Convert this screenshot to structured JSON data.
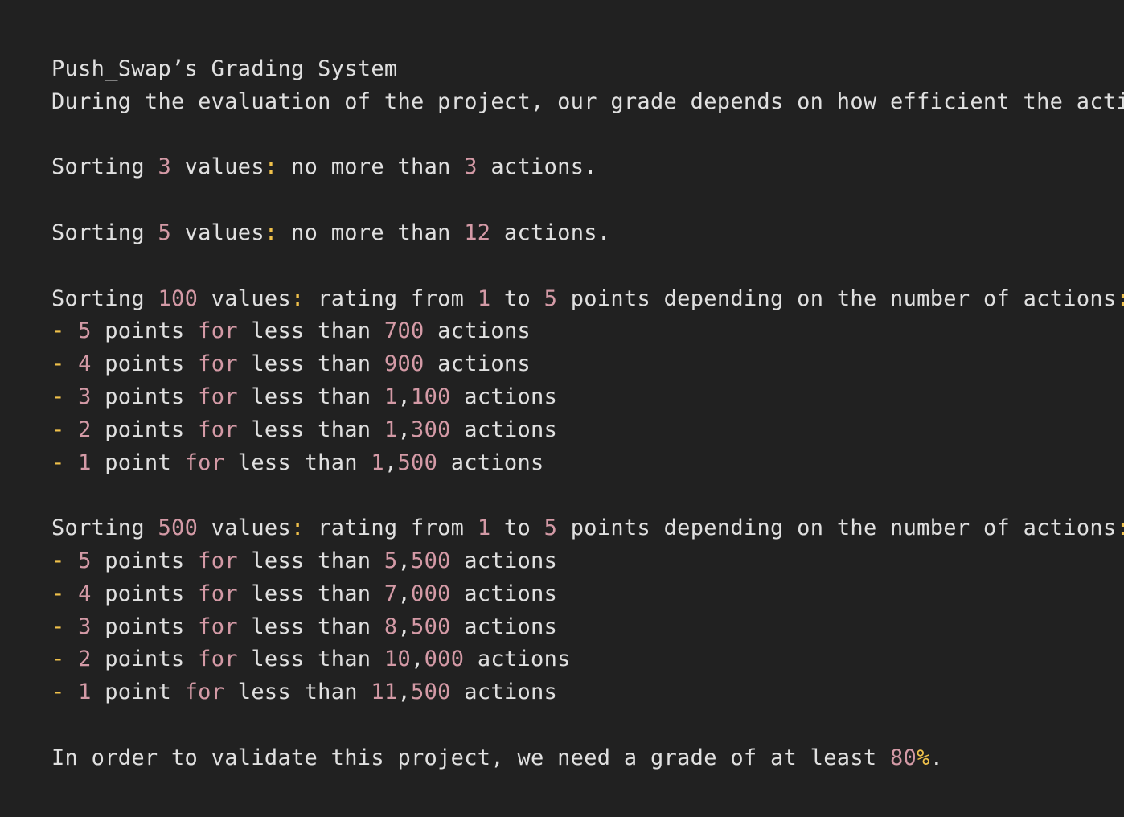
{
  "colors": {
    "background": "#212121",
    "text": "#e0e0e0",
    "number": "#d49aa6",
    "keyword": "#d49aa6",
    "punctuation": "#f0c14b"
  },
  "lines": [
    [
      {
        "t": "Push_Swap’s Grading System",
        "k": "plain"
      }
    ],
    [
      {
        "t": "During the evaluation of the project, our grade depends on how efficient the actions",
        "k": "plain"
      }
    ],
    [],
    [
      {
        "t": "Sorting ",
        "k": "plain"
      },
      {
        "t": "3",
        "k": "num"
      },
      {
        "t": " values",
        "k": "plain"
      },
      {
        "t": ":",
        "k": "punct"
      },
      {
        "t": " no more than ",
        "k": "plain"
      },
      {
        "t": "3",
        "k": "num"
      },
      {
        "t": " actions.",
        "k": "plain"
      }
    ],
    [],
    [
      {
        "t": "Sorting ",
        "k": "plain"
      },
      {
        "t": "5",
        "k": "num"
      },
      {
        "t": " values",
        "k": "plain"
      },
      {
        "t": ":",
        "k": "punct"
      },
      {
        "t": " no more than ",
        "k": "plain"
      },
      {
        "t": "12",
        "k": "num"
      },
      {
        "t": " actions.",
        "k": "plain"
      }
    ],
    [],
    [
      {
        "t": "Sorting ",
        "k": "plain"
      },
      {
        "t": "100",
        "k": "num"
      },
      {
        "t": " values",
        "k": "plain"
      },
      {
        "t": ":",
        "k": "punct"
      },
      {
        "t": " rating from ",
        "k": "plain"
      },
      {
        "t": "1",
        "k": "num"
      },
      {
        "t": " to ",
        "k": "plain"
      },
      {
        "t": "5",
        "k": "num"
      },
      {
        "t": " points depending on the number of actions",
        "k": "plain"
      },
      {
        "t": ":",
        "k": "punct"
      }
    ],
    [
      {
        "t": "-",
        "k": "dash"
      },
      {
        "t": " ",
        "k": "plain"
      },
      {
        "t": "5",
        "k": "num"
      },
      {
        "t": " points ",
        "k": "plain"
      },
      {
        "t": "for",
        "k": "kw"
      },
      {
        "t": " less than ",
        "k": "plain"
      },
      {
        "t": "700",
        "k": "num"
      },
      {
        "t": " actions",
        "k": "plain"
      }
    ],
    [
      {
        "t": "-",
        "k": "dash"
      },
      {
        "t": " ",
        "k": "plain"
      },
      {
        "t": "4",
        "k": "num"
      },
      {
        "t": " points ",
        "k": "plain"
      },
      {
        "t": "for",
        "k": "kw"
      },
      {
        "t": " less than ",
        "k": "plain"
      },
      {
        "t": "900",
        "k": "num"
      },
      {
        "t": " actions",
        "k": "plain"
      }
    ],
    [
      {
        "t": "-",
        "k": "dash"
      },
      {
        "t": " ",
        "k": "plain"
      },
      {
        "t": "3",
        "k": "num"
      },
      {
        "t": " points ",
        "k": "plain"
      },
      {
        "t": "for",
        "k": "kw"
      },
      {
        "t": " less than ",
        "k": "plain"
      },
      {
        "t": "1",
        "k": "num"
      },
      {
        "t": ",",
        "k": "plain"
      },
      {
        "t": "100",
        "k": "num"
      },
      {
        "t": " actions",
        "k": "plain"
      }
    ],
    [
      {
        "t": "-",
        "k": "dash"
      },
      {
        "t": " ",
        "k": "plain"
      },
      {
        "t": "2",
        "k": "num"
      },
      {
        "t": " points ",
        "k": "plain"
      },
      {
        "t": "for",
        "k": "kw"
      },
      {
        "t": " less than ",
        "k": "plain"
      },
      {
        "t": "1",
        "k": "num"
      },
      {
        "t": ",",
        "k": "plain"
      },
      {
        "t": "300",
        "k": "num"
      },
      {
        "t": " actions",
        "k": "plain"
      }
    ],
    [
      {
        "t": "-",
        "k": "dash"
      },
      {
        "t": " ",
        "k": "plain"
      },
      {
        "t": "1",
        "k": "num"
      },
      {
        "t": " point ",
        "k": "plain"
      },
      {
        "t": "for",
        "k": "kw"
      },
      {
        "t": " less than ",
        "k": "plain"
      },
      {
        "t": "1",
        "k": "num"
      },
      {
        "t": ",",
        "k": "plain"
      },
      {
        "t": "500",
        "k": "num"
      },
      {
        "t": " actions",
        "k": "plain"
      }
    ],
    [],
    [
      {
        "t": "Sorting ",
        "k": "plain"
      },
      {
        "t": "500",
        "k": "num"
      },
      {
        "t": " values",
        "k": "plain"
      },
      {
        "t": ":",
        "k": "punct"
      },
      {
        "t": " rating from ",
        "k": "plain"
      },
      {
        "t": "1",
        "k": "num"
      },
      {
        "t": " to ",
        "k": "plain"
      },
      {
        "t": "5",
        "k": "num"
      },
      {
        "t": " points depending on the number of actions",
        "k": "plain"
      },
      {
        "t": ":",
        "k": "punct"
      }
    ],
    [
      {
        "t": "-",
        "k": "dash"
      },
      {
        "t": " ",
        "k": "plain"
      },
      {
        "t": "5",
        "k": "num"
      },
      {
        "t": " points ",
        "k": "plain"
      },
      {
        "t": "for",
        "k": "kw"
      },
      {
        "t": " less than ",
        "k": "plain"
      },
      {
        "t": "5",
        "k": "num"
      },
      {
        "t": ",",
        "k": "plain"
      },
      {
        "t": "500",
        "k": "num"
      },
      {
        "t": " actions",
        "k": "plain"
      }
    ],
    [
      {
        "t": "-",
        "k": "dash"
      },
      {
        "t": " ",
        "k": "plain"
      },
      {
        "t": "4",
        "k": "num"
      },
      {
        "t": " points ",
        "k": "plain"
      },
      {
        "t": "for",
        "k": "kw"
      },
      {
        "t": " less than ",
        "k": "plain"
      },
      {
        "t": "7",
        "k": "num"
      },
      {
        "t": ",",
        "k": "plain"
      },
      {
        "t": "000",
        "k": "num"
      },
      {
        "t": " actions",
        "k": "plain"
      }
    ],
    [
      {
        "t": "-",
        "k": "dash"
      },
      {
        "t": " ",
        "k": "plain"
      },
      {
        "t": "3",
        "k": "num"
      },
      {
        "t": " points ",
        "k": "plain"
      },
      {
        "t": "for",
        "k": "kw"
      },
      {
        "t": " less than ",
        "k": "plain"
      },
      {
        "t": "8",
        "k": "num"
      },
      {
        "t": ",",
        "k": "plain"
      },
      {
        "t": "500",
        "k": "num"
      },
      {
        "t": " actions",
        "k": "plain"
      }
    ],
    [
      {
        "t": "-",
        "k": "dash"
      },
      {
        "t": " ",
        "k": "plain"
      },
      {
        "t": "2",
        "k": "num"
      },
      {
        "t": " points ",
        "k": "plain"
      },
      {
        "t": "for",
        "k": "kw"
      },
      {
        "t": " less than ",
        "k": "plain"
      },
      {
        "t": "10",
        "k": "num"
      },
      {
        "t": ",",
        "k": "plain"
      },
      {
        "t": "000",
        "k": "num"
      },
      {
        "t": " actions",
        "k": "plain"
      }
    ],
    [
      {
        "t": "-",
        "k": "dash"
      },
      {
        "t": " ",
        "k": "plain"
      },
      {
        "t": "1",
        "k": "num"
      },
      {
        "t": " point ",
        "k": "plain"
      },
      {
        "t": "for",
        "k": "kw"
      },
      {
        "t": " less than ",
        "k": "plain"
      },
      {
        "t": "11",
        "k": "num"
      },
      {
        "t": ",",
        "k": "plain"
      },
      {
        "t": "500",
        "k": "num"
      },
      {
        "t": " actions",
        "k": "plain"
      }
    ],
    [],
    [
      {
        "t": "In order to validate this project, we need a grade of at least ",
        "k": "plain"
      },
      {
        "t": "80",
        "k": "num"
      },
      {
        "t": "%",
        "k": "punct"
      },
      {
        "t": ".",
        "k": "plain"
      }
    ]
  ]
}
